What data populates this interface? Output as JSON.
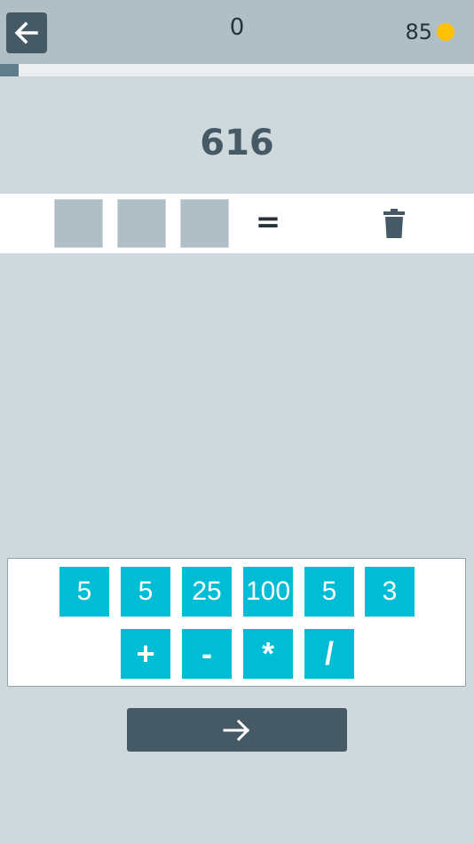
{
  "header": {
    "back_icon": "arrow-left-icon",
    "score": "0",
    "coins": "85",
    "coin_icon": "coin-icon",
    "coin_color": "#ffc107"
  },
  "progress": {
    "fraction": 0.04
  },
  "target": {
    "value": "616"
  },
  "expression": {
    "slots": [
      "",
      "",
      ""
    ],
    "equals": "=",
    "trash_icon": "trash-icon"
  },
  "keypad": {
    "numbers": [
      "5",
      "5",
      "25",
      "100",
      "5",
      "3"
    ],
    "operators": [
      "+",
      "-",
      "*",
      "/"
    ],
    "key_color": "#00bcd4"
  },
  "footer": {
    "next_icon": "arrow-right-icon"
  }
}
